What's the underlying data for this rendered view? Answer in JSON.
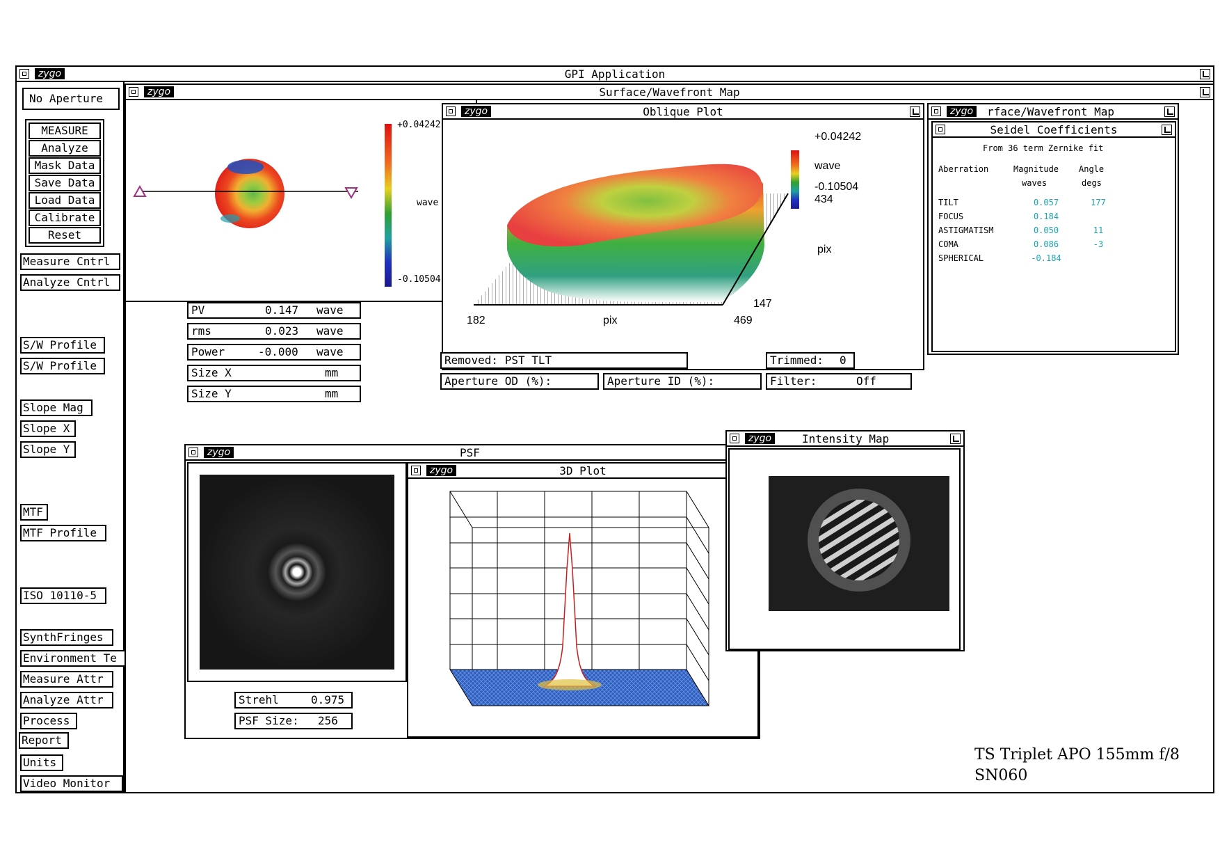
{
  "main_window": {
    "title": "GPI Application",
    "logo": "zygo"
  },
  "sidebar": {
    "aperture_button": "No Aperture",
    "primary_buttons": [
      "MEASURE",
      "Analyze",
      "Mask Data",
      "Save Data",
      "Load Data",
      "Calibrate",
      "Reset"
    ],
    "buttons": {
      "measure_cntrl": "Measure Cntrl",
      "analyze_cntrl": "Analyze Cntrl",
      "sw_profile_1": "S/W Profile",
      "sw_profile_2": "S/W Profile",
      "slope_mag": "Slope Mag",
      "slope_x": "Slope X",
      "slope_y": "Slope Y",
      "mtf": "MTF",
      "mtf_profile": "MTF Profile",
      "iso": "ISO 10110-5",
      "synth_fringes": "SynthFringes",
      "environment": "Environment Te",
      "measure_attr": "Measure Attr",
      "analyze_attr": "Analyze Attr",
      "process": "Process",
      "report": "Report",
      "units": "Units",
      "video_monitor": "Video Monitor"
    }
  },
  "surface_window": {
    "title": "Surface/Wavefront Map",
    "logo": "zygo",
    "colorbar": {
      "max": "+0.04242",
      "min": "-0.10504",
      "unit": "wave"
    }
  },
  "stats": {
    "pv": {
      "label": "PV",
      "value": "0.147",
      "unit": "wave"
    },
    "rms": {
      "label": "rms",
      "value": "0.023",
      "unit": "wave"
    },
    "power": {
      "label": "Power",
      "value": "-0.000",
      "unit": "wave"
    },
    "size_x": {
      "label": "Size X",
      "value": "",
      "unit": "mm"
    },
    "size_y": {
      "label": "Size Y",
      "value": "",
      "unit": "mm"
    }
  },
  "oblique_plot": {
    "title": "Oblique Plot",
    "logo": "zygo",
    "colorbar_max": "+0.04242",
    "colorbar_unit": "wave",
    "colorbar_min": "-0.10504",
    "y_top": "434",
    "y_unit": "pix",
    "y_bottom": "147",
    "x_left": "182",
    "x_unit": "pix",
    "x_right": "469"
  },
  "status_fields": {
    "removed": "Removed: PST TLT",
    "trimmed_label": "Trimmed:",
    "trimmed_value": "0",
    "aperture_od": "Aperture OD (%):",
    "aperture_id": "Aperture ID (%):",
    "filter_label": "Filter:",
    "filter_value": "Off"
  },
  "seidel": {
    "parent_title": "rface/Wavefront Map",
    "title": "Seidel Coefficients",
    "logo": "zygo",
    "subtitle": "From 36 term Zernike fit",
    "col_aberration": "Aberration",
    "col_magnitude": "Magnitude",
    "col_magnitude_unit": "waves",
    "col_angle": "Angle",
    "col_angle_unit": "degs",
    "rows": [
      {
        "name": "TILT",
        "magnitude": "0.057",
        "angle": "177"
      },
      {
        "name": "FOCUS",
        "magnitude": "0.184",
        "angle": ""
      },
      {
        "name": "ASTIGMATISM",
        "magnitude": "0.050",
        "angle": "11"
      },
      {
        "name": "COMA",
        "magnitude": "0.086",
        "angle": "-3"
      },
      {
        "name": "SPHERICAL",
        "magnitude": "-0.184",
        "angle": ""
      }
    ]
  },
  "psf_window": {
    "title": "PSF",
    "logo": "zygo",
    "strehl_label": "Strehl",
    "strehl_value": "0.975",
    "size_label": "PSF Size:",
    "size_value": "256"
  },
  "plot3d_window": {
    "title": "3D Plot",
    "logo": "zygo"
  },
  "intensity_window": {
    "title": "Intensity Map",
    "logo": "zygo"
  },
  "caption": {
    "line1": "TS Triplet APO 155mm f/8",
    "line2": "SN060"
  },
  "colors": {
    "teal_values": "#1aa5b5",
    "psf_floor": "#2c5fc0",
    "peak_red": "#c81e1e"
  }
}
